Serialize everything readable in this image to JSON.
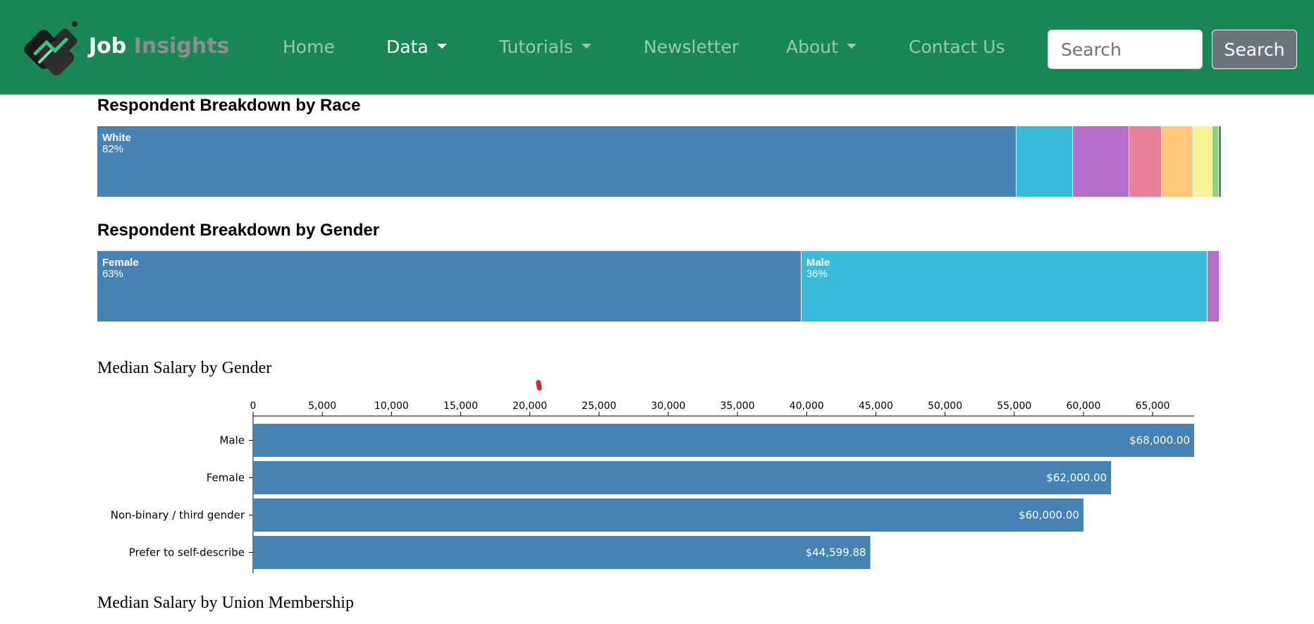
{
  "navbar": {
    "brand_part1": "Job",
    "brand_part2": "Insights",
    "links": [
      {
        "label": "Home",
        "dropdown": false,
        "active": false
      },
      {
        "label": "Data",
        "dropdown": true,
        "active": true
      },
      {
        "label": "Tutorials",
        "dropdown": true,
        "active": false
      },
      {
        "label": "Newsletter",
        "dropdown": false,
        "active": false
      },
      {
        "label": "About",
        "dropdown": true,
        "active": false
      },
      {
        "label": "Contact Us",
        "dropdown": false,
        "active": false
      }
    ],
    "search_placeholder": "Search",
    "search_button": "Search",
    "bg_color": "#198754"
  },
  "race_section": {
    "title": "Respondent Breakdown by Race",
    "segments": [
      {
        "label": "White",
        "value_text": "82%",
        "share": 82,
        "color": "#4682b4"
      },
      {
        "label": "",
        "value_text": "",
        "share": 5,
        "color": "#38bcdc"
      },
      {
        "label": "",
        "value_text": "",
        "share": 5,
        "color": "#b46fcb"
      },
      {
        "label": "",
        "value_text": "",
        "share": 2.8,
        "color": "#e97f9b"
      },
      {
        "label": "",
        "value_text": "",
        "share": 2.8,
        "color": "#ffc87a"
      },
      {
        "label": "",
        "value_text": "",
        "share": 1.6,
        "color": "#f5f597"
      },
      {
        "label": "",
        "value_text": "",
        "share": 0.5,
        "color": "#8fd17e"
      },
      {
        "label": "",
        "value_text": "",
        "share": 0.2,
        "color": "#3a9a56"
      }
    ]
  },
  "gender_section": {
    "title": "Respondent Breakdown by Gender",
    "segments": [
      {
        "label": "Female",
        "value_text": "63%",
        "share": 63,
        "color": "#4682b4"
      },
      {
        "label": "Male",
        "value_text": "36%",
        "share": 36.3,
        "color": "#38bcdc"
      },
      {
        "label": "",
        "value_text": "",
        "share": 1,
        "color": "#b46fcb"
      },
      {
        "label": "",
        "value_text": "",
        "share": 0.15,
        "color": "#ede0f0"
      }
    ]
  },
  "salary_section": {
    "title": "Median Salary by Gender"
  },
  "union_section": {
    "title": "Median Salary by Union Membership"
  },
  "chart_data": {
    "type": "bar",
    "orientation": "horizontal",
    "title": "Median Salary by Gender",
    "categories": [
      "Male",
      "Female",
      "Non-binary / third gender",
      "Prefer to self-describe"
    ],
    "values": [
      68000,
      62000,
      60000,
      44599.88
    ],
    "value_labels": [
      "$68,000.00",
      "$62,000.00",
      "$60,000.00",
      "$44,599.88"
    ],
    "x_ticks": [
      0,
      5000,
      10000,
      15000,
      20000,
      25000,
      30000,
      35000,
      40000,
      45000,
      50000,
      55000,
      60000,
      65000
    ],
    "x_tick_labels": [
      "0",
      "5,000",
      "10,000",
      "15,000",
      "20,000",
      "25,000",
      "30,000",
      "35,000",
      "40,000",
      "45,000",
      "50,000",
      "55,000",
      "60,000",
      "65,000"
    ],
    "xlim": [
      0,
      68000
    ],
    "x_axis_position": "top",
    "bar_color": "#4682b4",
    "grid": false
  }
}
